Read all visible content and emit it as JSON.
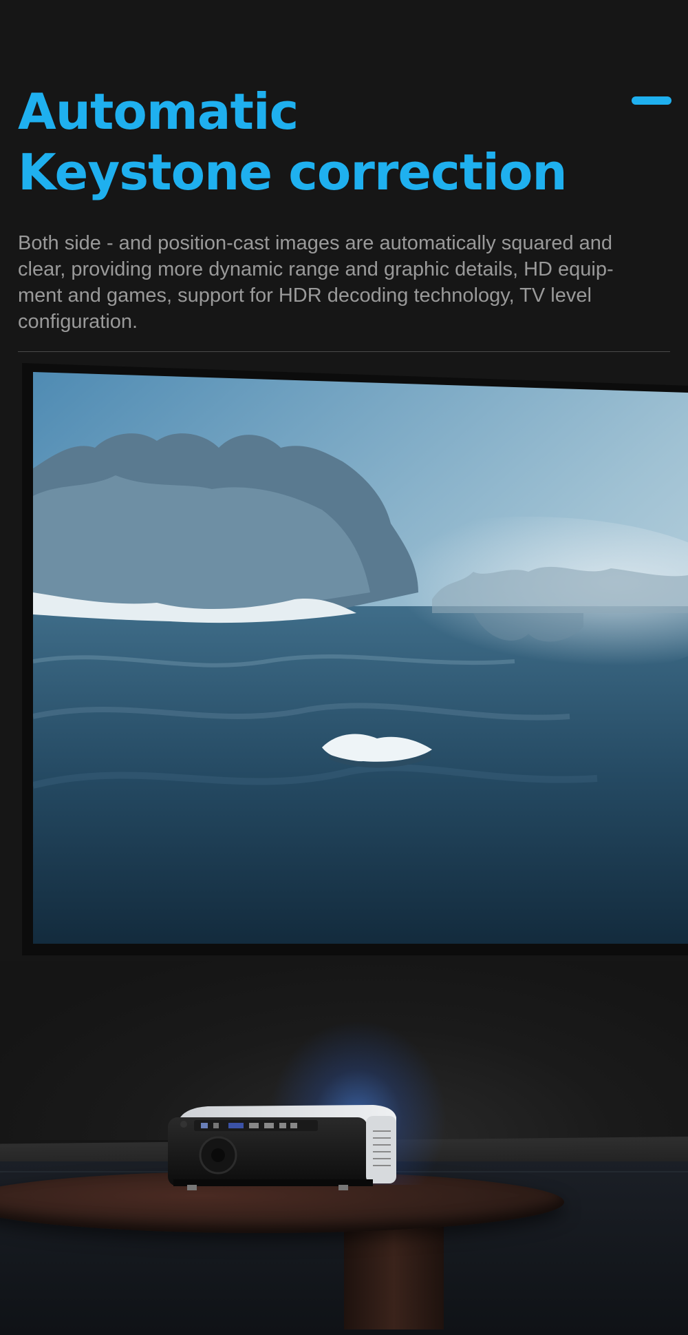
{
  "colors": {
    "accent": "#1fb0ef",
    "background": "#161616",
    "body_text": "#9a9a9a"
  },
  "header": {
    "title_line1": "Automatic",
    "title_line2": "Keystone correction",
    "description_lines": [
      "Both side - and position-cast images are automatically squared and",
      "clear, providing more dynamic range and graphic details, HD equip-",
      "ment and games, support for HDR decoding technology, TV level",
      "configuration."
    ]
  },
  "scene": {
    "screen_image": "winter-lake-landscape",
    "device_image": "projector",
    "furniture_image": "round-wooden-table"
  },
  "icons": {
    "accent": "dash-icon"
  }
}
